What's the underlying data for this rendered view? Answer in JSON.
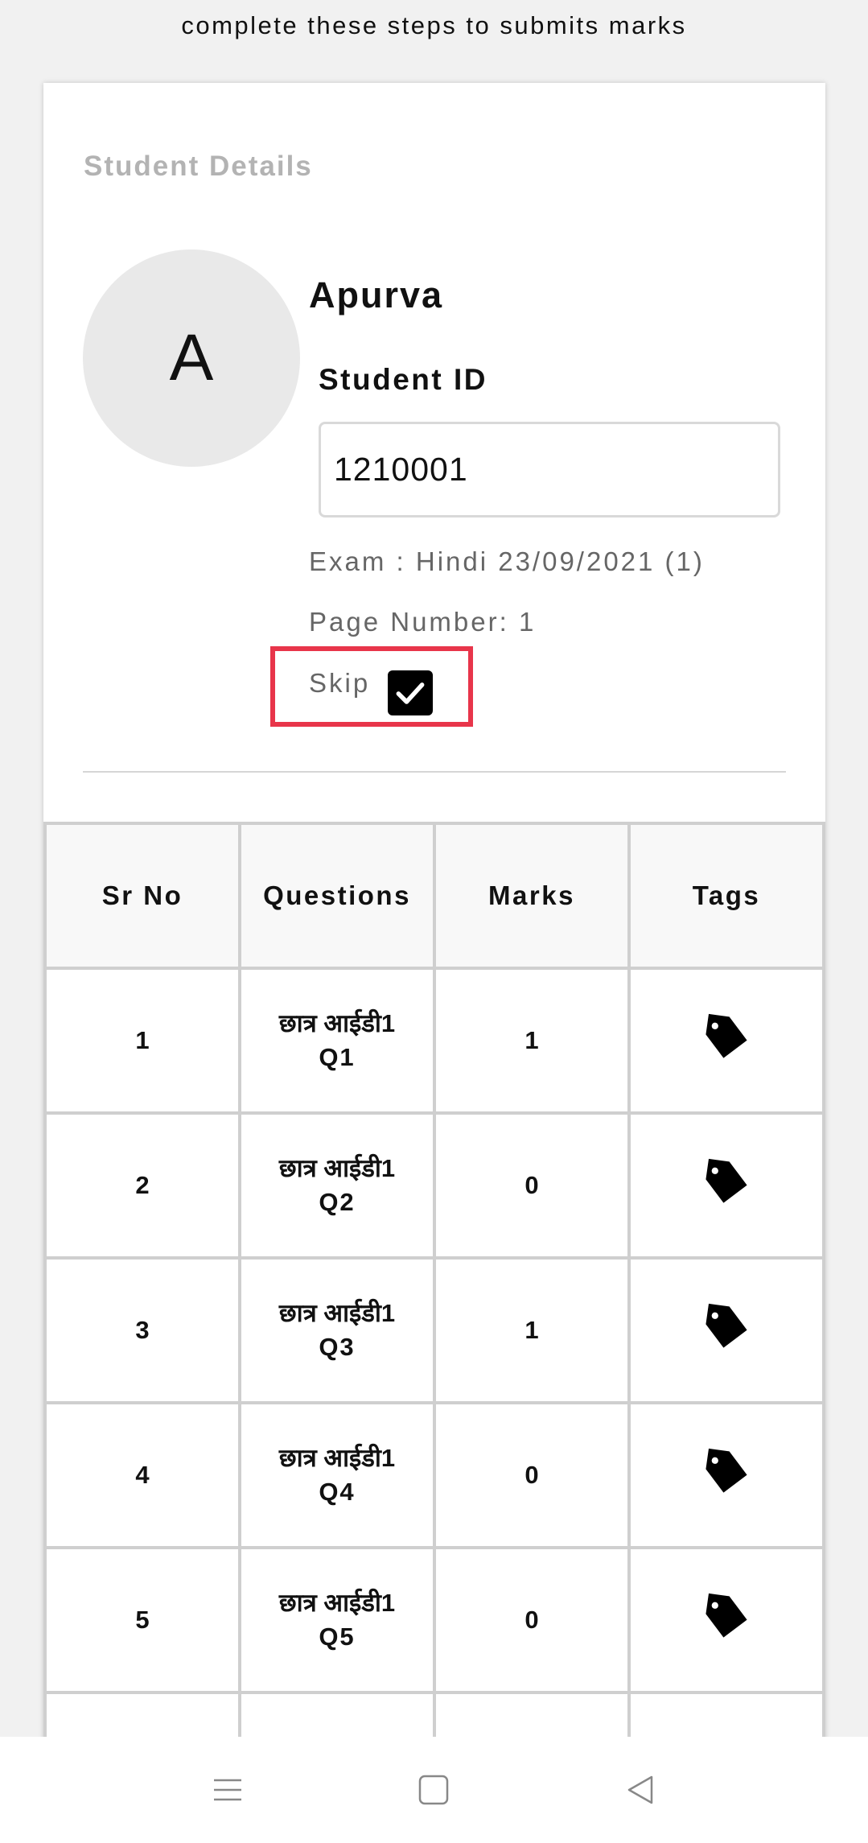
{
  "header": {
    "instruction": "complete these steps to submits marks"
  },
  "student": {
    "section_title": "Student Details",
    "avatar_initial": "A",
    "name": "Apurva",
    "id_label": "Student ID",
    "id_value": "1210001",
    "exam": "Exam : Hindi 23/09/2021 (1)",
    "page_number": "Page Number: 1",
    "skip_label": "Skip",
    "skip_checked": true
  },
  "table": {
    "headers": [
      "Sr No",
      "Questions",
      "Marks",
      "Tags"
    ],
    "rows": [
      {
        "sr": "1",
        "question_line1": "छात्र आईडी1",
        "question_line2": "Q1",
        "marks": "1",
        "tag_icon": "tag-icon"
      },
      {
        "sr": "2",
        "question_line1": "छात्र आईडी1",
        "question_line2": "Q2",
        "marks": "0",
        "tag_icon": "tag-icon"
      },
      {
        "sr": "3",
        "question_line1": "छात्र आईडी1",
        "question_line2": "Q3",
        "marks": "1",
        "tag_icon": "tag-icon"
      },
      {
        "sr": "4",
        "question_line1": "छात्र आईडी1",
        "question_line2": "Q4",
        "marks": "0",
        "tag_icon": "tag-icon"
      },
      {
        "sr": "5",
        "question_line1": "छात्र आईडी1",
        "question_line2": "Q5",
        "marks": "0",
        "tag_icon": "tag-icon"
      },
      {
        "sr": "",
        "question_line1": "",
        "question_line2": "",
        "marks": "",
        "tag_icon": ""
      }
    ]
  },
  "nav": {
    "icons": [
      "menu-icon",
      "home-square-icon",
      "back-triangle-icon"
    ]
  },
  "colors": {
    "highlight": "#e8354a",
    "checkbox": "#000000",
    "muted_text": "#666666",
    "section_title": "#b3b3b3"
  }
}
